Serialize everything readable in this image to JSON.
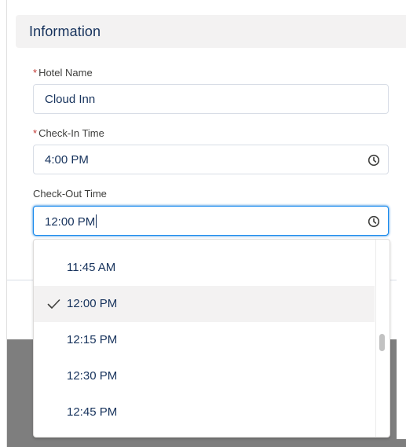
{
  "section": {
    "title": "Information"
  },
  "fields": {
    "hotel_name": {
      "label": "Hotel Name",
      "required_marker": "*",
      "value": "Cloud Inn"
    },
    "check_in": {
      "label": "Check-In Time",
      "required_marker": "*",
      "value": "4:00 PM",
      "icon": "clock-icon"
    },
    "check_out": {
      "label": "Check-Out Time",
      "value": "12:00 PM",
      "icon": "clock-icon"
    }
  },
  "time_dropdown": {
    "selected": "12:00 PM",
    "options": [
      {
        "label": "11:45 AM"
      },
      {
        "label": "12:00 PM",
        "selected": true,
        "icon": "check-icon"
      },
      {
        "label": "12:15 PM"
      },
      {
        "label": "12:30 PM"
      },
      {
        "label": "12:45 PM"
      }
    ]
  },
  "colors": {
    "accent": "#1589ee",
    "required": "#c23934",
    "text": "#16325c",
    "header_bg": "#f3f2f2"
  }
}
